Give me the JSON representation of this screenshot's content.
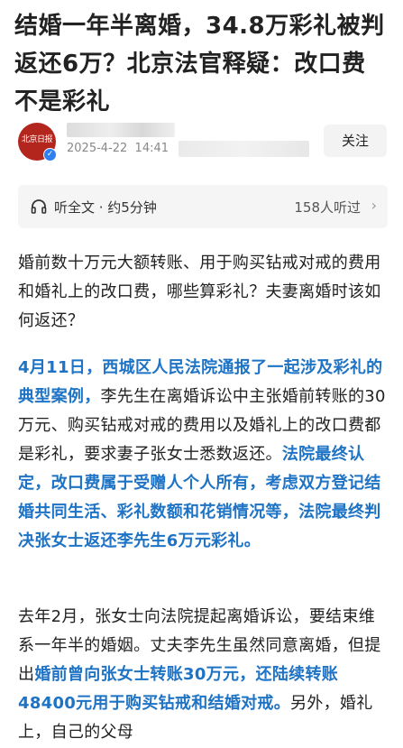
{
  "article": {
    "title": "结婚一年半离婚，34.8万彩礼被判返还6万？北京法官释疑：改口费不是彩礼"
  },
  "author": {
    "avatar_text": "北京日报",
    "post_date": "2025-4-22",
    "post_time": "14:41",
    "follow_label": "关注"
  },
  "listen_bar": {
    "icon": "headphones-icon",
    "label": "听全文 · 约5分钟",
    "count": "158人听过",
    "chevron": "›"
  },
  "paragraphs": [
    [
      {
        "text": "婚前数十万元大额转账、用于购买钻戒对戒的费用和婚礼上的改口费，哪些算彩礼？夫妻离婚时该如何返还？",
        "highlight": false
      }
    ],
    [
      {
        "text": "4月11日，西城区人民法院通报了一起涉及彩礼的典型案例，",
        "highlight": true
      },
      {
        "text": "李先生在离婚诉讼中主张婚前转账的30万元、购买钻戒对戒的费用以及婚礼上的改口费都是彩礼，要求妻子张女士悉数返还。",
        "highlight": false
      },
      {
        "text": "法院最终认定，改口费属于受赠人个人所有，考虑双方登记结婚共同生活、彩礼数额和花销情况等，法院最终判决张女士返还李先生6万元彩礼。",
        "highlight": true
      }
    ],
    [
      {
        "text": "去年2月，张女士向法院提起离婚诉讼，要结束维系一年半的婚姻。丈夫李先生虽然同意离婚，但提出",
        "highlight": false
      },
      {
        "text": "婚前曾向张女士转账30万元，还陆续转账48400元用于购买钻戒和结婚对戒。",
        "highlight": true
      },
      {
        "text": "另外，婚礼上，自己的父母",
        "highlight": false
      }
    ]
  ],
  "colors": {
    "highlight": "#1e73c5",
    "avatar_bg": "#b3261e",
    "verified": "#2f7ff0"
  }
}
